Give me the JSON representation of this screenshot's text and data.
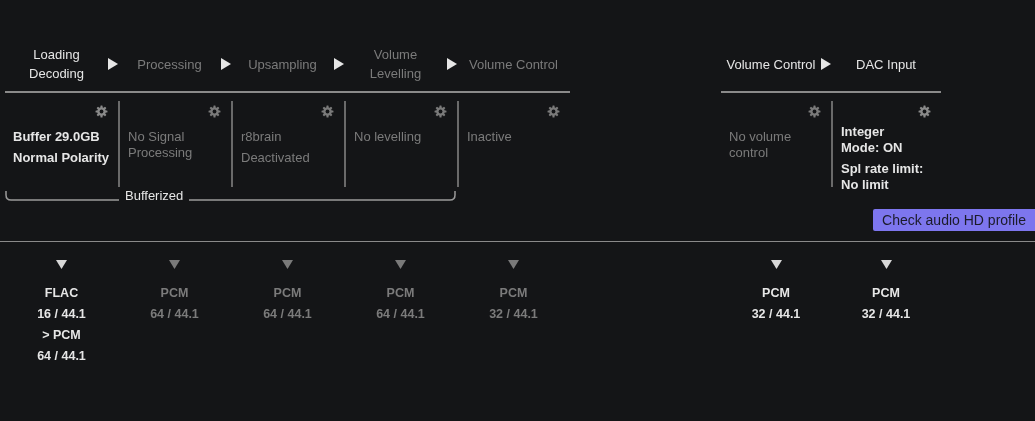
{
  "chains": [
    {
      "kind": "main",
      "stages": [
        {
          "label": "Loading\nDecoding",
          "active": true,
          "cell": {
            "active": true,
            "lines": [
              "Buffer 29.0GB",
              "Normal Polarity"
            ]
          },
          "format": {
            "active": true,
            "lines": [
              "FLAC",
              "16 / 44.1",
              "> PCM",
              "64 / 44.1"
            ]
          }
        },
        {
          "label": "Processing",
          "active": false,
          "cell": {
            "active": false,
            "lines": [
              "No Signal\nProcessing"
            ]
          },
          "format": {
            "active": false,
            "lines": [
              "PCM",
              "64 / 44.1"
            ]
          }
        },
        {
          "label": "Upsampling",
          "active": false,
          "cell": {
            "active": false,
            "lines": [
              "r8brain",
              "Deactivated"
            ]
          },
          "format": {
            "active": false,
            "lines": [
              "PCM",
              "64 / 44.1"
            ]
          }
        },
        {
          "label": "Volume\nLevelling",
          "active": false,
          "cell": {
            "active": false,
            "lines": [
              "No levelling"
            ]
          },
          "format": {
            "active": false,
            "lines": [
              "PCM",
              "64 / 44.1"
            ]
          }
        },
        {
          "label": "Volume Control",
          "active": false,
          "cell": {
            "active": false,
            "lines": [
              "Inactive"
            ]
          },
          "format": {
            "active": false,
            "lines": [
              "PCM",
              "32 / 44.1"
            ]
          }
        }
      ],
      "bracket": "Bufferized"
    },
    {
      "kind": "output",
      "stages": [
        {
          "label": "Volume Control",
          "active": true,
          "cell": {
            "active": false,
            "lines": [
              "No volume\ncontrol"
            ]
          },
          "format": {
            "active": true,
            "lines": [
              "PCM",
              "32 / 44.1"
            ]
          }
        },
        {
          "label": "DAC Input",
          "active": true,
          "cell": {
            "active": true,
            "lines": [
              "Integer\nMode: ON",
              "Spl rate limit:\nNo limit"
            ]
          },
          "format": {
            "active": true,
            "lines": [
              "PCM",
              "32 / 44.1"
            ]
          }
        }
      ]
    }
  ],
  "button": "Check audio HD profile"
}
